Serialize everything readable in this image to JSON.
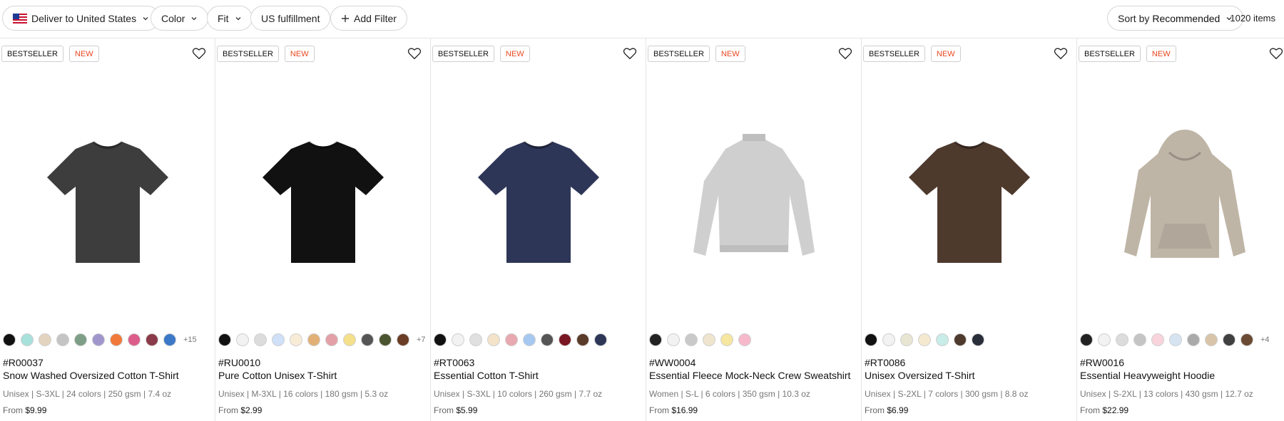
{
  "filters": {
    "deliver_label": "Deliver to United States",
    "color_label": "Color",
    "fit_label": "Fit",
    "us_fulfillment_label": "US fulfillment",
    "add_filter_label": "Add Filter"
  },
  "sort": {
    "prefix": "Sort by",
    "value": "Recommended"
  },
  "item_count": "1020 items",
  "badges": {
    "bestseller": "BESTSELLER",
    "new": "NEW"
  },
  "price_prefix": "From",
  "products": [
    {
      "sku": "#R00037",
      "name": "Snow Washed Oversized Cotton T-Shirt",
      "specs": "Unisex | S-3XL | 24 colors | 250 gsm | 7.4 oz",
      "price": "$9.99",
      "garment": "tshirt",
      "fill": "#3d3d3d",
      "swatches": [
        "#111111",
        "#a8e0dc",
        "#e3d4bf",
        "#c4c4c4",
        "#7e9e87",
        "#a096cc",
        "#f07a3a",
        "#dc5d8a",
        "#8a3a4a",
        "#3c78c8"
      ],
      "more": "+15"
    },
    {
      "sku": "#RU0010",
      "name": "Pure Cotton Unisex T-Shirt",
      "specs": "Unisex | M-3XL | 16 colors | 180 gsm | 5.3 oz",
      "price": "$2.99",
      "garment": "tshirt",
      "fill": "#111111",
      "swatches": [
        "#111111",
        "#f2f2f2",
        "#dcdcdc",
        "#cfe0f8",
        "#f9ecd6",
        "#e2b077",
        "#e3a0a6",
        "#f5e08a",
        "#555555",
        "#4a5530",
        "#6b3d24"
      ],
      "more": "+7"
    },
    {
      "sku": "#RT0063",
      "name": "Essential Cotton T-Shirt",
      "specs": "Unisex | S-3XL | 10 colors | 260 gsm | 7.7 oz",
      "price": "$5.99",
      "garment": "tshirt",
      "fill": "#2e3657",
      "swatches": [
        "#111111",
        "#f2f2f2",
        "#e0e0e0",
        "#f3e3c8",
        "#e8a8b0",
        "#a6c8f0",
        "#555555",
        "#7a1622",
        "#5a3a28",
        "#2e3657"
      ],
      "more": ""
    },
    {
      "sku": "#WW0004",
      "name": "Essential Fleece Mock-Neck Crew Sweatshirt",
      "specs": "Women | S-L | 6 colors | 350 gsm | 10.3 oz",
      "price": "$16.99",
      "garment": "sweatshirt",
      "fill": "#cfcfcf",
      "swatches": [
        "#222222",
        "#f2f2f2",
        "#c9c9c9",
        "#efe5cf",
        "#f5e6a0",
        "#f7b8cc"
      ],
      "more": ""
    },
    {
      "sku": "#RT0086",
      "name": "Unisex Oversized T-Shirt",
      "specs": "Unisex | S-2XL | 7 colors | 300 gsm | 8.8 oz",
      "price": "$6.99",
      "garment": "tshirt",
      "fill": "#4e392d",
      "swatches": [
        "#111111",
        "#f2f2f2",
        "#e8e6d2",
        "#f5ead0",
        "#c8ece8",
        "#4e392d",
        "#2a2e3a"
      ],
      "more": ""
    },
    {
      "sku": "#RW0016",
      "name": "Essential Heavyweight Hoodie",
      "specs": "Unisex | S-2XL | 13 colors | 430 gsm | 12.7 oz",
      "price": "$22.99",
      "garment": "hoodie",
      "fill": "#bfb5a6",
      "swatches": [
        "#222222",
        "#f2f2f2",
        "#dcdcdc",
        "#c4c4c4",
        "#f9d4dc",
        "#d6e4f2",
        "#aaaaaa",
        "#d8c4a8",
        "#404040",
        "#6b4a34"
      ],
      "more": "+4"
    }
  ]
}
